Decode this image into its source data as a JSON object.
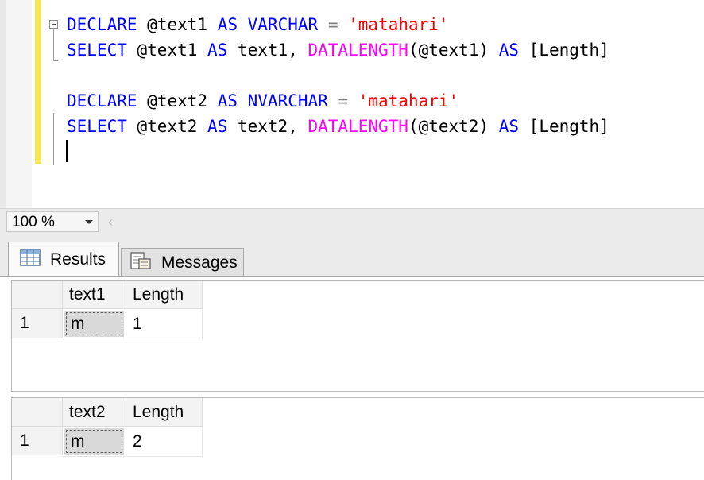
{
  "editor": {
    "lines": [
      {
        "kind": "declare",
        "keyword": "DECLARE",
        "var": "@text1",
        "as": "AS",
        "type": "VARCHAR",
        "eq": "=",
        "str": "'matahari'"
      },
      {
        "kind": "select",
        "keyword": "SELECT",
        "var": "@text1",
        "as": "AS",
        "alias": "text1,",
        "fn": "DATALENGTH",
        "arg": "(@text1)",
        "as2": "AS",
        "col": "[Length]"
      },
      {
        "kind": "blank"
      },
      {
        "kind": "declare",
        "keyword": "DECLARE",
        "var": "@text2",
        "as": "AS",
        "type": "NVARCHAR",
        "eq": "=",
        "str": "'matahari'"
      },
      {
        "kind": "select",
        "keyword": "SELECT",
        "var": "@text2",
        "as": "AS",
        "alias": "text2,",
        "fn": "DATALENGTH",
        "arg": "(@text2)",
        "as2": "AS",
        "col": "[Length]"
      }
    ]
  },
  "zoom": {
    "value": "100 %",
    "scroll_left_glyph": "‹"
  },
  "tabs": [
    {
      "label": "Results",
      "icon": "grid-icon",
      "active": true
    },
    {
      "label": "Messages",
      "icon": "messages-icon",
      "active": false
    }
  ],
  "results": [
    {
      "columns": [
        "text1",
        "Length"
      ],
      "rows": [
        {
          "num": "1",
          "cells": [
            "m",
            "1"
          ]
        }
      ]
    },
    {
      "columns": [
        "text2",
        "Length"
      ],
      "rows": [
        {
          "num": "1",
          "cells": [
            "m",
            "2"
          ]
        }
      ]
    }
  ],
  "colors": {
    "keyword": "#0000ff",
    "function": "#ff00ff",
    "string": "#ff0000",
    "change_bar": "#f4e45a"
  }
}
